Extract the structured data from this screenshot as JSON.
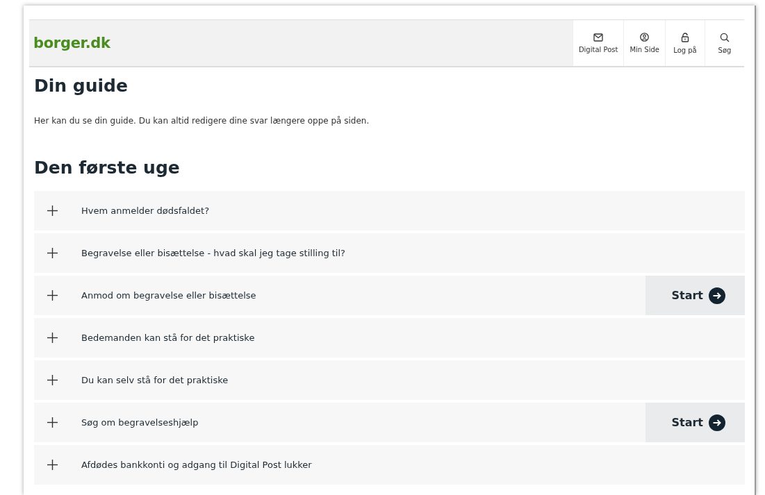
{
  "header": {
    "logo": "borger.dk",
    "nav": [
      {
        "kind": "mail",
        "label": "Digital Post"
      },
      {
        "kind": "user",
        "label": "Min Side"
      },
      {
        "kind": "lock",
        "label": "Log på"
      },
      {
        "kind": "search",
        "label": "Søg"
      }
    ]
  },
  "title": "Din guide",
  "intro": "Her kan du se din guide. Du kan altid redigere dine svar længere oppe på siden.",
  "section": {
    "heading": "Den første uge",
    "items": [
      {
        "label": "Hvem anmelder dødsfaldet?",
        "expanded": false
      },
      {
        "label": "Begravelse eller bisættelse - hvad skal jeg tage stilling til?",
        "expanded": false
      },
      {
        "label": "Anmod om begravelse eller bisættelse",
        "expanded": false,
        "action": "Start"
      },
      {
        "label": "Bedemanden kan stå for det praktiske",
        "expanded": false
      },
      {
        "label": "Du kan selv stå for det praktiske",
        "expanded": false
      },
      {
        "label": "Søg om begravelseshjælp",
        "expanded": false,
        "action": "Start"
      },
      {
        "label": "Afdødes bankkonti og adgang til Digital Post lukker",
        "expanded": false
      }
    ]
  }
}
